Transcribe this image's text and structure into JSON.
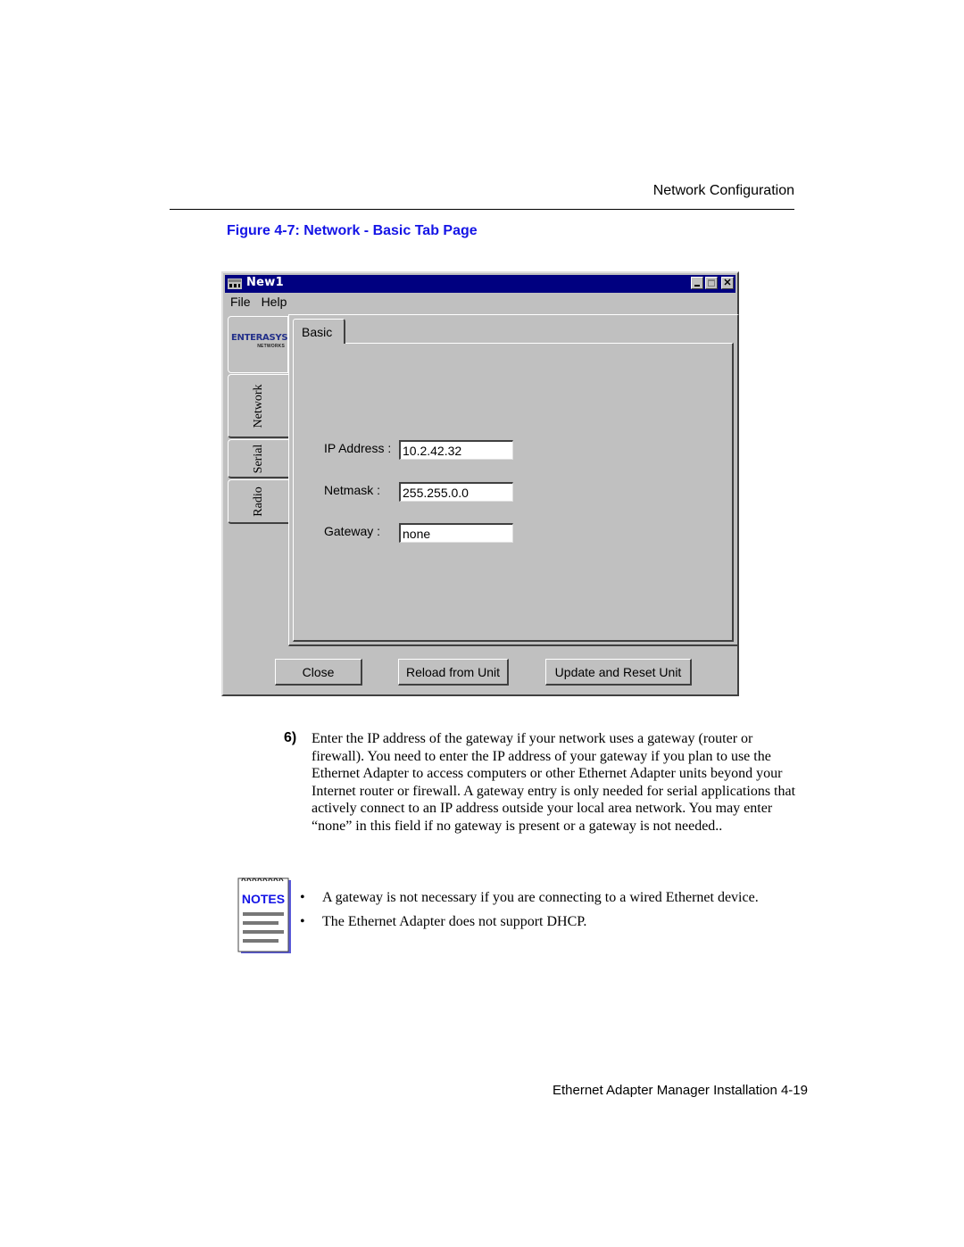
{
  "page": {
    "running_header": "Network Configuration",
    "figure_caption": "Figure  4-7: Network -  Basic Tab Page",
    "footer": "Ethernet Adapter Manager Installation 4-19"
  },
  "window": {
    "title": "New1",
    "icons": {
      "app": "app-window-icon",
      "minimize": "minimize-icon",
      "maximize": "maximize-icon",
      "close": "close-icon"
    },
    "menu": [
      "File",
      "Help"
    ],
    "logo": {
      "main": "ENTERASYS",
      "sub": "NETWORKS"
    },
    "side_tabs": [
      "Network",
      "Serial",
      "Radio"
    ],
    "active_side_tab": "Network",
    "inner_tabs": [
      "Basic"
    ],
    "fields": [
      {
        "label": "IP Address :",
        "value": "10.2.42.32"
      },
      {
        "label": "Netmask :",
        "value": "255.255.0.0"
      },
      {
        "label": "Gateway :",
        "value": "none"
      }
    ],
    "buttons": {
      "close": "Close",
      "reload": "Reload from Unit",
      "update": "Update and Reset Unit"
    },
    "colors": {
      "titlebar": "#000080",
      "face": "#c0c0c0"
    }
  },
  "step": {
    "number": "6)",
    "text": "Enter the IP address of the gateway if your network uses a gateway (router or firewall). You need to enter the IP address of your gateway if you plan to use the Ethernet Adapter to access computers or other Ethernet Adapter units beyond your Internet router or firewall. A gateway entry is only needed for serial applications that actively connect to an IP address outside your local area network. You may enter “none” in this field if no gateway is present or a gateway is not needed.."
  },
  "notes": {
    "icon_label": "NOTES",
    "bullet_char": "•",
    "items": [
      "A gateway is not necessary if you are connecting to a wired Ethernet device.",
      "The Ethernet Adapter does not support DHCP."
    ]
  }
}
